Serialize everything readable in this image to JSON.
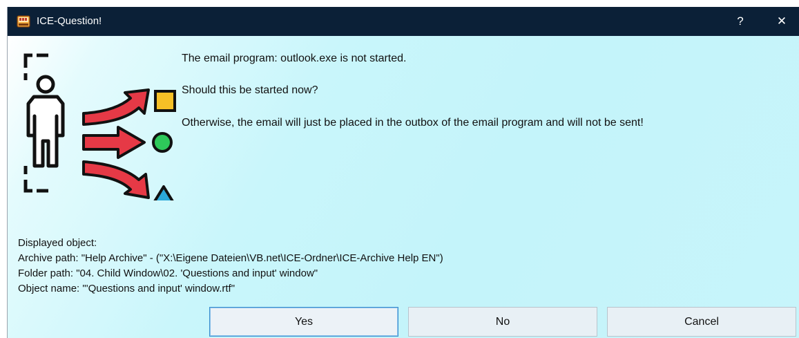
{
  "window": {
    "title": "ICE-Question!",
    "help_label": "?",
    "close_label": "✕"
  },
  "icons": {
    "app": "ice-app-icon",
    "illustration": "person-choices-illustration"
  },
  "message": {
    "line1": "The email program: outlook.exe is not started.",
    "line2": "Should this be started now?",
    "line3": "Otherwise, the email will just be placed in the outbox of the email program and will not be sent!"
  },
  "info": {
    "line1": "Displayed object:",
    "line2": "Archive path: \"Help Archive\" - (\"X:\\Eigene Dateien\\VB.net\\ICE-Ordner\\ICE-Archive Help EN\")",
    "line3": "Folder path: \"04. Child Window\\02. 'Questions and input' window\"",
    "line4": "Object name: \"'Questions and input' window.rtf\""
  },
  "buttons": {
    "yes": "Yes",
    "no": "No",
    "cancel": "Cancel"
  },
  "colors": {
    "titlebar": "#0b2037",
    "background": "#c7f5fb",
    "arrow": "#e63946",
    "square": "#f6c026",
    "circle": "#2ec95a",
    "triangle": "#2aa7d9"
  }
}
